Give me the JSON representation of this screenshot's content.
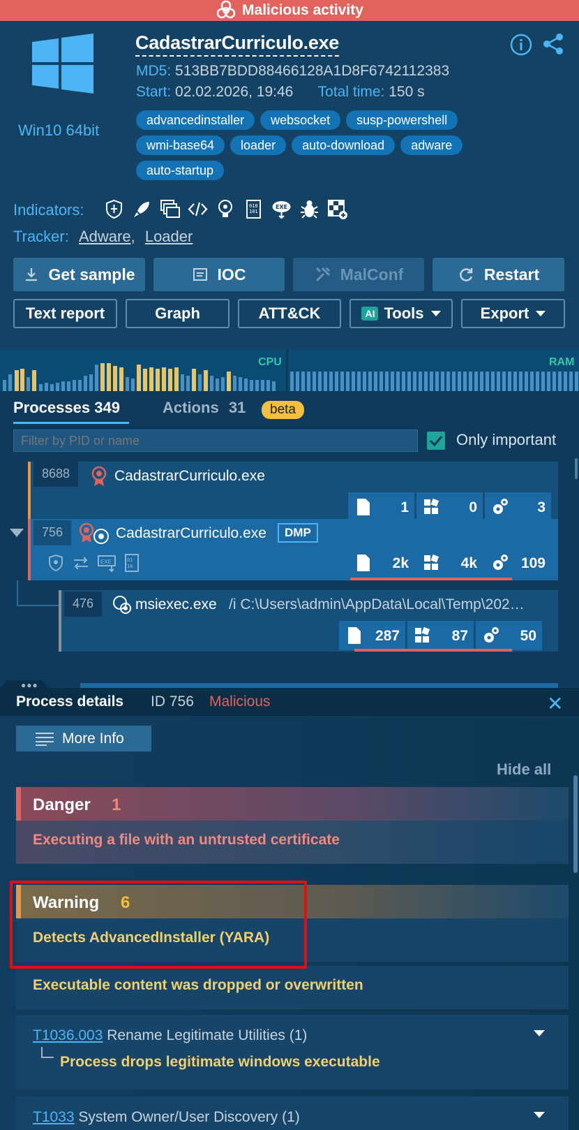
{
  "banner": {
    "label": "Malicious activity",
    "color": "#e0645d",
    "icon": "biohazard-icon"
  },
  "header": {
    "os_label": "Win10 64bit",
    "os_icon": "windows-logo-icon",
    "filename": "CadastrarCurriculo.exe",
    "md5_label": "MD5:",
    "md5": "513BB7BDD88466128A1D8F6742112383",
    "start_label": "Start:",
    "start": "02.02.2026, 19:46",
    "total_label": "Total time:",
    "total": "150 s",
    "tags": [
      "advancedinstaller",
      "websocket",
      "susp-powershell",
      "wmi-base64",
      "loader",
      "auto-download",
      "adware",
      "auto-startup"
    ],
    "indicators_label": "Indicators:",
    "indicator_icons": [
      "shield-icon",
      "rocket-icon",
      "windows-stack-icon",
      "code-icon",
      "brain-icon",
      "binary-file-icon",
      "exe-download-icon",
      "bug-icon",
      "flag-grid-icon"
    ],
    "tracker_label": "Tracker:",
    "tracker_links": [
      "Adware",
      "Loader"
    ]
  },
  "buttons": {
    "get_sample": "Get sample",
    "ioc": "IOC",
    "malconf": "MalConf",
    "restart": "Restart",
    "text_report": "Text report",
    "graph": "Graph",
    "attck": "ATT&CK",
    "ai_badge": "AI",
    "tools": "Tools",
    "export": "Export"
  },
  "graph": {
    "cpu_label": "CPU",
    "ram_label": "RAM"
  },
  "tabs": {
    "processes_label": "Processes",
    "processes_count": "349",
    "actions_label": "Actions",
    "actions_count": "31",
    "beta": "beta"
  },
  "filter": {
    "placeholder": "Filter by PID or name",
    "only_important": "Only important",
    "only_important_checked": true
  },
  "processes": [
    {
      "pid": "8688",
      "name": "CadastrarCurriculo.exe",
      "files": "1",
      "registry": "0",
      "modules": "3"
    },
    {
      "pid": "756",
      "name": "CadastrarCurriculo.exe",
      "badge": "DMP",
      "files": "2k",
      "registry": "4k",
      "modules": "109"
    },
    {
      "pid": "476",
      "name": "msiexec.exe",
      "args": "/i C:\\Users\\admin\\AppData\\Local\\Temp\\202…",
      "files": "287",
      "registry": "87",
      "modules": "50"
    }
  ],
  "details": {
    "title": "Process details",
    "id": "ID 756",
    "verdict": "Malicious",
    "more_info": "More Info",
    "hide_all": "Hide all",
    "danger": {
      "label": "Danger",
      "count": "1",
      "items": [
        "Executing a file with an untrusted certificate"
      ]
    },
    "warning": {
      "label": "Warning",
      "count": "6",
      "items": [
        "Detects AdvancedInstaller (YARA)",
        "Executable content was dropped or overwritten"
      ]
    },
    "techniques": [
      {
        "code": "T1036.003",
        "name": "Rename Legitimate Utilities (1)",
        "items": [
          "Process drops legitimate windows executable"
        ]
      },
      {
        "code": "T1033",
        "name": "System Owner/User Discovery (1)",
        "items": []
      }
    ]
  }
}
